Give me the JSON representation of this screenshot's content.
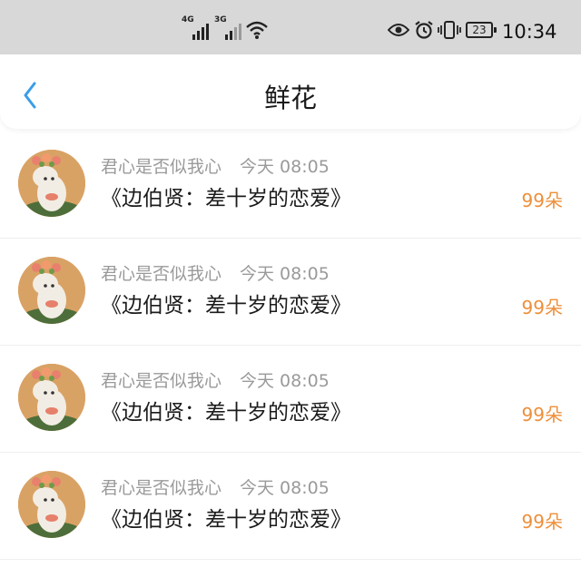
{
  "status_bar": {
    "network_1": "4G",
    "network_2": "3G",
    "battery": "23",
    "time": "10:34",
    "icons": [
      "signal-icon",
      "wifi-icon",
      "eye-icon",
      "alarm-icon",
      "vibrate-icon",
      "battery-icon"
    ]
  },
  "header": {
    "title": "鲜花",
    "back_icon": "chevron-left-icon"
  },
  "colors": {
    "accent": "#3b9ee8",
    "count": "#ee8f3a",
    "meta": "#9a9a9a"
  },
  "items": [
    {
      "user": "君心是否似我心",
      "time": "今天 08:05",
      "title": "《边伯贤：差十岁的恋爱》",
      "count": "99朵"
    },
    {
      "user": "君心是否似我心",
      "time": "今天 08:05",
      "title": "《边伯贤：差十岁的恋爱》",
      "count": "99朵"
    },
    {
      "user": "君心是否似我心",
      "time": "今天 08:05",
      "title": "《边伯贤：差十岁的恋爱》",
      "count": "99朵"
    },
    {
      "user": "君心是否似我心",
      "time": "今天 08:05",
      "title": "《边伯贤：差十岁的恋爱》",
      "count": "99朵"
    }
  ]
}
